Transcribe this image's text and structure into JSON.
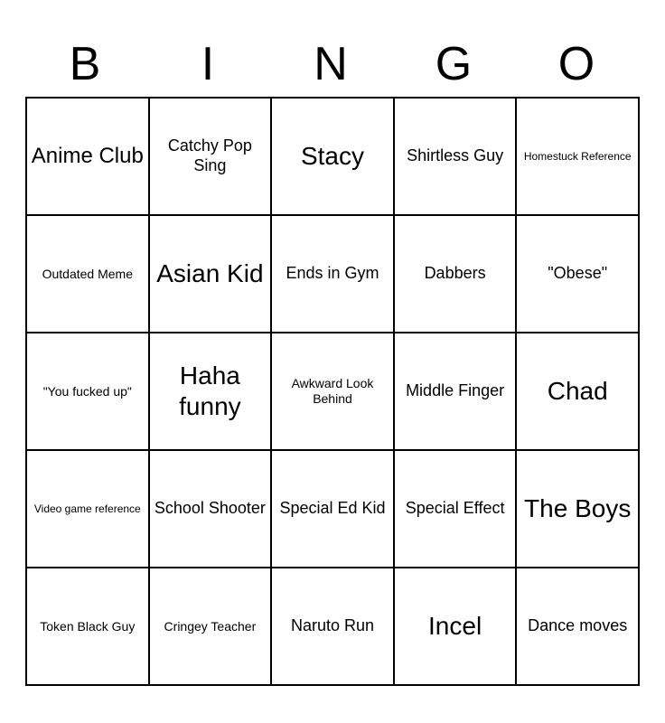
{
  "header": {
    "letters": [
      "B",
      "I",
      "N",
      "G",
      "O"
    ]
  },
  "cells": [
    {
      "text": "Anime Club",
      "size": "size-lg"
    },
    {
      "text": "Catchy Pop Sing",
      "size": "size-md"
    },
    {
      "text": "Stacy",
      "size": "size-xl"
    },
    {
      "text": "Shirtless Guy",
      "size": "size-md"
    },
    {
      "text": "Homestuck Reference",
      "size": "size-xs"
    },
    {
      "text": "Outdated Meme",
      "size": "size-sm"
    },
    {
      "text": "Asian Kid",
      "size": "size-xl"
    },
    {
      "text": "Ends in Gym",
      "size": "size-md"
    },
    {
      "text": "Dabbers",
      "size": "size-md"
    },
    {
      "text": "\"Obese\"",
      "size": "size-md"
    },
    {
      "text": "\"You fucked up\"",
      "size": "size-sm"
    },
    {
      "text": "Haha funny",
      "size": "size-xl"
    },
    {
      "text": "Awkward Look Behind",
      "size": "size-sm"
    },
    {
      "text": "Middle Finger",
      "size": "size-md"
    },
    {
      "text": "Chad",
      "size": "size-xl"
    },
    {
      "text": "Video game reference",
      "size": "size-xs"
    },
    {
      "text": "School Shooter",
      "size": "size-md"
    },
    {
      "text": "Special Ed Kid",
      "size": "size-md"
    },
    {
      "text": "Special Effect",
      "size": "size-md"
    },
    {
      "text": "The Boys",
      "size": "size-xl"
    },
    {
      "text": "Token Black Guy",
      "size": "size-sm"
    },
    {
      "text": "Cringey Teacher",
      "size": "size-sm"
    },
    {
      "text": "Naruto Run",
      "size": "size-md"
    },
    {
      "text": "Incel",
      "size": "size-xl"
    },
    {
      "text": "Dance moves",
      "size": "size-md"
    }
  ]
}
